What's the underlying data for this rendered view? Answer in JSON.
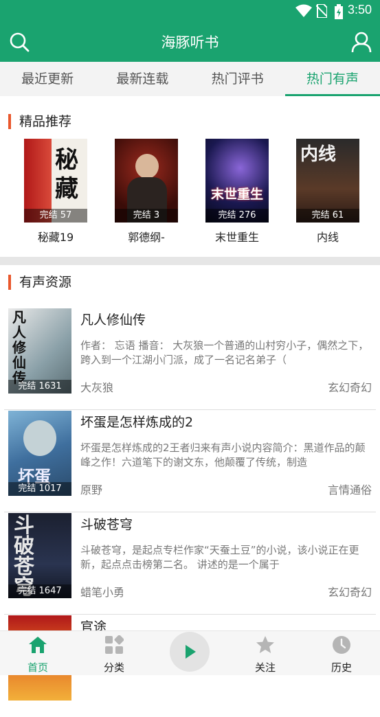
{
  "status_bar": {
    "time": "3:50"
  },
  "app_bar": {
    "title": "海豚听书"
  },
  "tabs": [
    {
      "label": "最近更新"
    },
    {
      "label": "最新连载"
    },
    {
      "label": "热门评书"
    },
    {
      "label": "热门有声",
      "active": true
    }
  ],
  "recommend": {
    "heading": "精品推荐",
    "items": [
      {
        "name": "秘藏19",
        "badge": "完结 57",
        "cover_text": "秘藏"
      },
      {
        "name": "郭德纲-",
        "badge": "完结 3"
      },
      {
        "name": "末世重生",
        "badge": "完结 276",
        "cover_text": "末世重生"
      },
      {
        "name": "内线",
        "badge": "完结 61",
        "cover_text": "内线"
      }
    ]
  },
  "audio": {
    "heading": "有声资源",
    "items": [
      {
        "title": "凡人修仙传",
        "badge": "完结 1631",
        "cover_text": "凡人修仙传",
        "desc": "作者： 忘语 播音： 大灰狼一个普通的山村穷小子，偶然之下，跨入到一个江湖小门派，成了一名记名弟子（",
        "author": "大灰狼",
        "category": "玄幻奇幻"
      },
      {
        "title": "坏蛋是怎样炼成的2",
        "badge": "完结 1017",
        "cover_text": "坏蛋",
        "desc": "坏蛋是怎样炼成的2王者归来有声小说内容简介：黑道作品的颠峰之作！六道笔下的谢文东，他颠覆了传统，制造",
        "author": "原野",
        "category": "言情通俗"
      },
      {
        "title": "斗破苍穹",
        "badge": "完结 1647",
        "cover_text": "斗破苍穹",
        "desc": " 斗破苍穹，是起点专栏作家“天蚕土豆”的小说，该小说正在更新，起点点击榜第二名。 讲述的是一个属于",
        "author": "蜡笔小勇",
        "category": "玄幻奇幻"
      },
      {
        "title": "官途",
        "badge": "",
        "desc": "",
        "author": "",
        "category": ""
      }
    ]
  },
  "bottom_nav": [
    {
      "label": "首页",
      "icon": "home-icon",
      "active": true
    },
    {
      "label": "分类",
      "icon": "category-icon"
    },
    {
      "label": "关注",
      "icon": "star-icon"
    },
    {
      "label": "历史",
      "icon": "clock-icon"
    }
  ],
  "colors": {
    "primary": "#1aa36f",
    "accent_bar": "#e9572c"
  }
}
